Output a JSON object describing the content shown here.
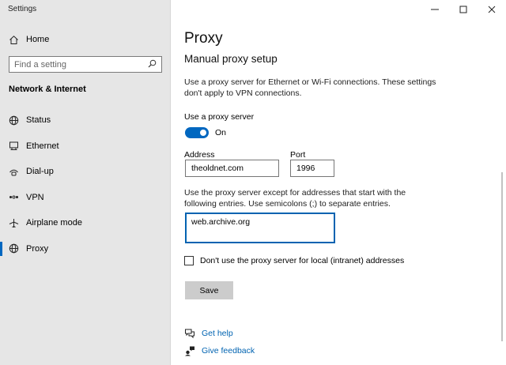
{
  "window": {
    "title": "Settings"
  },
  "sidebar": {
    "home_label": "Home",
    "search_placeholder": "Find a setting",
    "section_title": "Network & Internet",
    "items": [
      {
        "label": "Status",
        "icon": "globe-icon"
      },
      {
        "label": "Ethernet",
        "icon": "ethernet-icon"
      },
      {
        "label": "Dial-up",
        "icon": "dialup-icon"
      },
      {
        "label": "VPN",
        "icon": "vpn-icon"
      },
      {
        "label": "Airplane mode",
        "icon": "airplane-icon"
      },
      {
        "label": "Proxy",
        "icon": "globe-icon",
        "active": true
      }
    ]
  },
  "main": {
    "title": "Proxy",
    "subheading": "Manual proxy setup",
    "description": "Use a proxy server for Ethernet or Wi-Fi connections. These settings don't apply to VPN connections.",
    "use_proxy_label": "Use a proxy server",
    "toggle_state": "On",
    "address_label": "Address",
    "address_value": "theoldnet.com",
    "port_label": "Port",
    "port_value": "1996",
    "exceptions_description": "Use the proxy server except for addresses that start with the following entries. Use semicolons (;) to separate entries.",
    "exceptions_value": "web.archive.org",
    "local_checkbox_label": "Don't use the proxy server for local (intranet) addresses",
    "local_checkbox_checked": false,
    "save_label": "Save",
    "get_help_label": "Get help",
    "give_feedback_label": "Give feedback"
  },
  "colors": {
    "accent": "#0067c0",
    "link": "#0063b1",
    "sidebar_bg": "#e6e6e6"
  }
}
